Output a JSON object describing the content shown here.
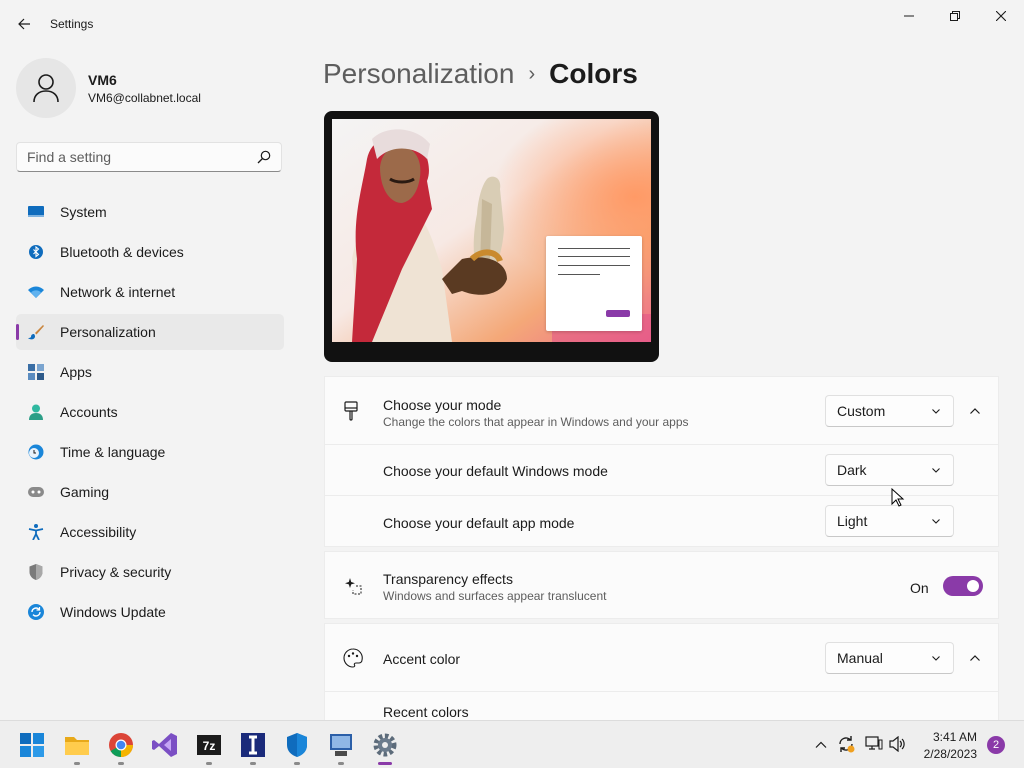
{
  "window": {
    "title": "Settings"
  },
  "profile": {
    "name": "VM6",
    "email": "VM6@collabnet.local"
  },
  "search": {
    "placeholder": "Find a setting"
  },
  "sidebar": {
    "items": [
      {
        "label": "System",
        "icon": "monitor-icon",
        "active": false
      },
      {
        "label": "Bluetooth & devices",
        "icon": "bluetooth-icon",
        "active": false
      },
      {
        "label": "Network & internet",
        "icon": "wifi-icon",
        "active": false
      },
      {
        "label": "Personalization",
        "icon": "brush-icon",
        "active": true
      },
      {
        "label": "Apps",
        "icon": "apps-icon",
        "active": false
      },
      {
        "label": "Accounts",
        "icon": "person-icon",
        "active": false
      },
      {
        "label": "Time & language",
        "icon": "clock-globe-icon",
        "active": false
      },
      {
        "label": "Gaming",
        "icon": "gamepad-icon",
        "active": false
      },
      {
        "label": "Accessibility",
        "icon": "accessibility-icon",
        "active": false
      },
      {
        "label": "Privacy & security",
        "icon": "shield-icon",
        "active": false
      },
      {
        "label": "Windows Update",
        "icon": "update-icon",
        "active": false
      }
    ]
  },
  "breadcrumb": {
    "parent": "Personalization",
    "separator": "›",
    "current": "Colors"
  },
  "mode_card": {
    "title": "Choose your mode",
    "description": "Change the colors that appear in Windows and your apps",
    "value": "Custom",
    "windows_mode": {
      "label": "Choose your default Windows mode",
      "value": "Dark"
    },
    "app_mode": {
      "label": "Choose your default app mode",
      "value": "Light"
    }
  },
  "transparency": {
    "title": "Transparency effects",
    "description": "Windows and surfaces appear translucent",
    "state": "On"
  },
  "accent": {
    "title": "Accent color",
    "value": "Manual",
    "recent_label": "Recent colors"
  },
  "taskbar": {
    "apps": [
      "start-icon",
      "file-explorer-icon",
      "chrome-icon",
      "visual-studio-icon",
      "7zip-icon",
      "app-i-icon",
      "defender-icon",
      "network-app-icon",
      "settings-icon"
    ],
    "time": "3:41 AM",
    "date": "2/28/2023",
    "notifications": "2"
  },
  "colors": {
    "accent": "#8a3aa8",
    "background": "#f3f3f3",
    "card": "#fbfbfb"
  }
}
